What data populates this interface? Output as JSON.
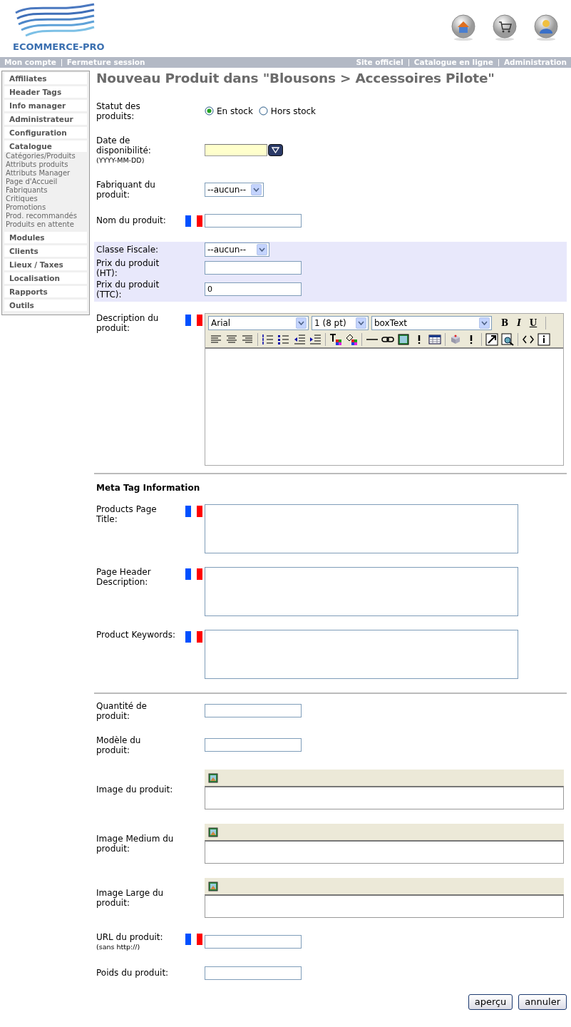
{
  "header": {
    "logo_text": "ECOMMERCE-PRO"
  },
  "top_bar": {
    "left_links": [
      "Mon compte",
      "Fermeture session"
    ],
    "right_links": [
      "Site officiel",
      "Catalogue en ligne",
      "Administration"
    ]
  },
  "sidebar": {
    "items": [
      {
        "label": "Affiliates"
      },
      {
        "label": "Header Tags"
      },
      {
        "label": "Info manager"
      },
      {
        "label": "Administrateur"
      },
      {
        "label": "Configuration"
      },
      {
        "label": "Catalogue",
        "children": [
          {
            "label": "Catégories/Produits"
          },
          {
            "label": "Attributs produits"
          },
          {
            "label": "Attributs Manager"
          },
          {
            "label": "Page d'Accueil"
          },
          {
            "label": "Fabriquants"
          },
          {
            "label": "Critiques"
          },
          {
            "label": "Promotions"
          },
          {
            "label": "Prod. recommandés"
          },
          {
            "label": "Produits en attente"
          }
        ]
      },
      {
        "label": "Modules"
      },
      {
        "label": "Clients"
      },
      {
        "label": "Lieux / Taxes"
      },
      {
        "label": "Localisation"
      },
      {
        "label": "Rapports"
      },
      {
        "label": "Outils"
      }
    ]
  },
  "page_title": "Nouveau Produit dans \"Blousons > Accessoires Pilote\"",
  "fields": [
    {
      "kind": "radio",
      "label": "Statut des produits:",
      "options": [
        {
          "label": "En stock",
          "selected": true
        },
        {
          "label": "Hors stock",
          "selected": false
        }
      ]
    },
    {
      "kind": "date",
      "label": "Date de disponibilité:",
      "hint": "(YYYY-MM-DD)"
    },
    {
      "kind": "select",
      "label": "Fabriquant du produit:",
      "value": "--aucun--"
    },
    {
      "kind": "text",
      "label": "Nom du produit:",
      "flag": true
    },
    {
      "kind": "select",
      "label": "Classe Fiscale:",
      "value": "--aucun--",
      "shaded": true
    },
    {
      "kind": "text",
      "label": "Prix du produit (HT):",
      "shaded": true
    },
    {
      "kind": "text",
      "label": "Prix du produit (TTC):",
      "value": "0",
      "shaded": true
    },
    {
      "kind": "editor",
      "label": "Description du produit:",
      "flag": true,
      "font": "Arial",
      "size": "1 (8 pt)",
      "style": "boxText",
      "format_buttons": [
        "B",
        "I",
        "U"
      ]
    },
    {
      "kind": "divider"
    },
    {
      "kind": "heading",
      "label": "Meta Tag Information"
    },
    {
      "kind": "textarea",
      "label": "Products Page Title:",
      "flag": true
    },
    {
      "kind": "textarea",
      "label": "Page Header Description:",
      "flag": true
    },
    {
      "kind": "textarea",
      "label": "Product Keywords:",
      "flag": true
    },
    {
      "kind": "divider"
    },
    {
      "kind": "text",
      "label": "Quantité de produit:"
    },
    {
      "kind": "text",
      "label": "Modèle du produit:"
    },
    {
      "kind": "image",
      "label": "Image du produit:"
    },
    {
      "kind": "image",
      "label": "Image Medium du produit:"
    },
    {
      "kind": "image",
      "label": "Image Large du produit:"
    },
    {
      "kind": "text",
      "label": "URL du produit:",
      "hint": "(sans http://)",
      "flag": true
    },
    {
      "kind": "text",
      "label": "Poids du produit:"
    }
  ],
  "buttons": [
    "aperçu",
    "annuler"
  ]
}
